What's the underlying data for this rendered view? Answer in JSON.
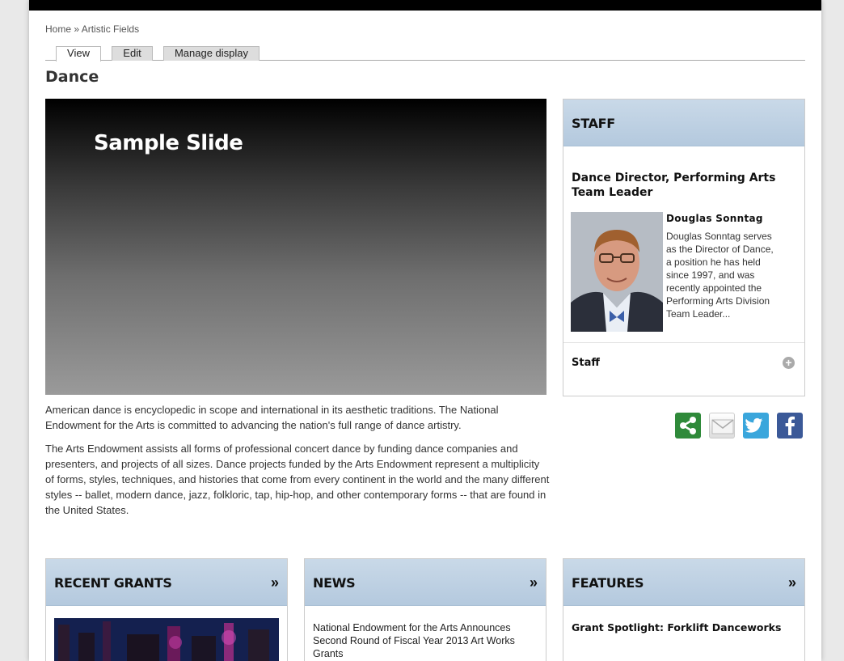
{
  "breadcrumb": {
    "home": "Home",
    "separator": "»",
    "current": "Artistic Fields"
  },
  "tabs": [
    {
      "label": "View",
      "active": true
    },
    {
      "label": "Edit",
      "active": false
    },
    {
      "label": "Manage display",
      "active": false
    }
  ],
  "page_title": "Dance",
  "slide": {
    "title": "Sample Slide"
  },
  "body": {
    "p1": "American dance is encyclopedic in scope and international in its aesthetic traditions. The National Endowment for the Arts is committed to advancing the nation's full range of dance artistry.",
    "p2": "The Arts Endowment assists all forms of professional concert dance by funding dance companies and presenters, and projects of all sizes. Dance projects funded by the Arts Endowment represent a multiplicity of forms, styles, techniques, and histories that come from every continent in the world and the many different styles -- ballet, modern dance, jazz, folkloric, tap, hip-hop, and other contemporary forms -- that are found in the United States."
  },
  "staff": {
    "header": "STAFF",
    "role": "Dance Director, Performing Arts Team Leader",
    "name": "Douglas Sonntag",
    "bio": "Douglas Sonntag serves as the Director of Dance, a position he has held since 1997, and was recently appointed the Performing Arts Division Team Leader...",
    "link": "Staff"
  },
  "social": {
    "share": "share-icon",
    "email": "email-icon",
    "twitter": "twitter-icon",
    "facebook": "facebook-icon"
  },
  "bottom": {
    "grants": {
      "header": "RECENT GRANTS",
      "more": "»"
    },
    "news": {
      "header": "NEWS",
      "more": "»",
      "item": "National Endowment for the Arts Announces Second Round of Fiscal Year 2013 Art Works Grants"
    },
    "features": {
      "header": "FEATURES",
      "more": "»",
      "item": "Grant Spotlight: Forklift Danceworks"
    }
  },
  "colors": {
    "box_header": "#b9cde0",
    "share": "#2f8a3a",
    "twitter": "#3aa6dc",
    "facebook": "#3b5998"
  }
}
